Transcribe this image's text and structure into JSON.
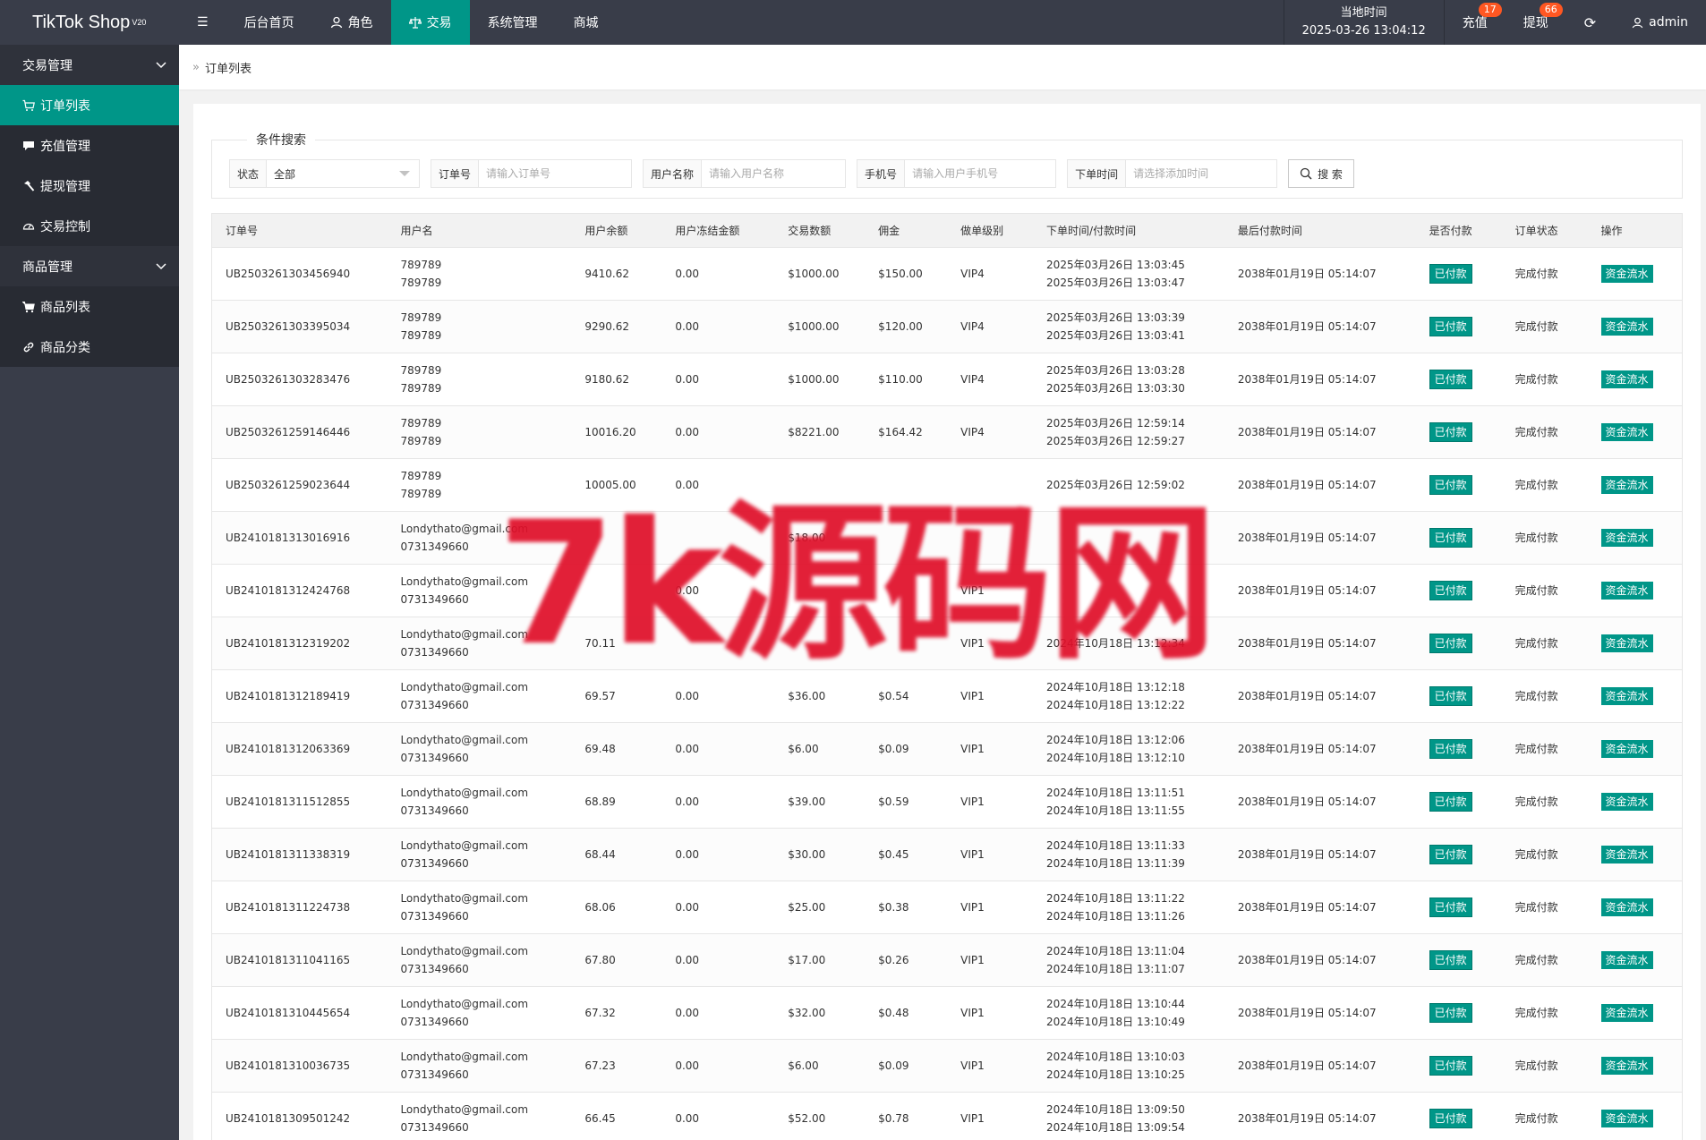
{
  "app": {
    "title": "TikTok Shop",
    "version": "V20"
  },
  "topnav": {
    "items": [
      {
        "label": "后台首页",
        "icon": "menu-icon"
      },
      {
        "label": "角色",
        "icon": "user-icon"
      },
      {
        "label": "交易",
        "icon": "scale-icon",
        "active": true
      },
      {
        "label": "系统管理",
        "icon": ""
      },
      {
        "label": "商城",
        "icon": ""
      }
    ],
    "clock_label": "当地时间",
    "clock_value": "2025-03-26 13:04:12",
    "recharge_label": "充值",
    "recharge_count": "17",
    "withdraw_label": "提现",
    "withdraw_count": "66",
    "user_label": "admin"
  },
  "sidebar": {
    "groups": [
      {
        "label": "交易管理",
        "items": [
          {
            "label": "订单列表",
            "icon": "cart-icon",
            "active": true
          },
          {
            "label": "充值管理",
            "icon": "chat-icon"
          },
          {
            "label": "提现管理",
            "icon": "hammer-icon"
          },
          {
            "label": "交易控制",
            "icon": "gauge-icon"
          }
        ]
      },
      {
        "label": "商品管理",
        "items": [
          {
            "label": "商品列表",
            "icon": "cart-icon"
          },
          {
            "label": "商品分类",
            "icon": "link-icon"
          }
        ]
      }
    ]
  },
  "breadcrumb": {
    "current": "订单列表"
  },
  "search": {
    "legend": "条件搜索",
    "status_label": "状态",
    "status_value": "全部",
    "order_label": "订单号",
    "order_placeholder": "请输入订单号",
    "username_label": "用户名称",
    "username_placeholder": "请输入用户名称",
    "phone_label": "手机号",
    "phone_placeholder": "请输入用户手机号",
    "time_label": "下单时间",
    "time_placeholder": "请选择添加时间",
    "button_label": "搜 索"
  },
  "table": {
    "headers": [
      "订单号",
      "用户名",
      "用户余额",
      "用户冻结金额",
      "交易数额",
      "佣金",
      "做单级别",
      "下单时间/付款时间",
      "最后付款时间",
      "是否付款",
      "订单状态",
      "操作"
    ],
    "paid_label": "已付款",
    "status_label": "完成付款",
    "action_label": "资金流水",
    "rows": [
      {
        "order": "UB2503261303456940",
        "user1": "789789",
        "user2": "789789",
        "balance": "9410.62",
        "frozen": "0.00",
        "amount": "$1000.00",
        "commission": "$150.00",
        "level": "VIP4",
        "t1": "2025年03月26日 13:03:45",
        "t2": "2025年03月26日 13:03:47",
        "last": "2038年01月19日 05:14:07"
      },
      {
        "order": "UB2503261303395034",
        "user1": "789789",
        "user2": "789789",
        "balance": "9290.62",
        "frozen": "0.00",
        "amount": "$1000.00",
        "commission": "$120.00",
        "level": "VIP4",
        "t1": "2025年03月26日 13:03:39",
        "t2": "2025年03月26日 13:03:41",
        "last": "2038年01月19日 05:14:07"
      },
      {
        "order": "UB2503261303283476",
        "user1": "789789",
        "user2": "789789",
        "balance": "9180.62",
        "frozen": "0.00",
        "amount": "$1000.00",
        "commission": "$110.00",
        "level": "VIP4",
        "t1": "2025年03月26日 13:03:28",
        "t2": "2025年03月26日 13:03:30",
        "last": "2038年01月19日 05:14:07"
      },
      {
        "order": "UB2503261259146446",
        "user1": "789789",
        "user2": "789789",
        "balance": "10016.20",
        "frozen": "0.00",
        "amount": "$8221.00",
        "commission": "$164.42",
        "level": "VIP4",
        "t1": "2025年03月26日 12:59:14",
        "t2": "2025年03月26日 12:59:27",
        "last": "2038年01月19日 05:14:07"
      },
      {
        "order": "UB2503261259023644",
        "user1": "789789",
        "user2": "789789",
        "balance": "10005.00",
        "frozen": "0.00",
        "amount": "",
        "commission": "",
        "level": "",
        "t1": "2025年03月26日 12:59:02",
        "t2": "",
        "last": "2038年01月19日 05:14:07"
      },
      {
        "order": "UB2410181313016916",
        "user1": "Londythato@gmail.com",
        "user2": "0731349660",
        "balance": "",
        "frozen": "",
        "amount": "$18.00",
        "commission": "",
        "level": "",
        "t1": "",
        "t2": "",
        "last": "2038年01月19日 05:14:07"
      },
      {
        "order": "UB2410181312424768",
        "user1": "Londythato@gmail.com",
        "user2": "0731349660",
        "balance": "",
        "frozen": "0.00",
        "amount": "",
        "commission": "",
        "level": "VIP1",
        "t1": "",
        "t2": "",
        "last": "2038年01月19日 05:14:07"
      },
      {
        "order": "UB2410181312319202",
        "user1": "Londythato@gmail.com",
        "user2": "0731349660",
        "balance": "70.11",
        "frozen": "",
        "amount": "",
        "commission": "",
        "level": "VIP1",
        "t1": "",
        "t2": "2024年10月18日 13:12:34",
        "last": "2038年01月19日 05:14:07"
      },
      {
        "order": "UB2410181312189419",
        "user1": "Londythato@gmail.com",
        "user2": "0731349660",
        "balance": "69.57",
        "frozen": "0.00",
        "amount": "$36.00",
        "commission": "$0.54",
        "level": "VIP1",
        "t1": "2024年10月18日 13:12:18",
        "t2": "2024年10月18日 13:12:22",
        "last": "2038年01月19日 05:14:07"
      },
      {
        "order": "UB2410181312063369",
        "user1": "Londythato@gmail.com",
        "user2": "0731349660",
        "balance": "69.48",
        "frozen": "0.00",
        "amount": "$6.00",
        "commission": "$0.09",
        "level": "VIP1",
        "t1": "2024年10月18日 13:12:06",
        "t2": "2024年10月18日 13:12:10",
        "last": "2038年01月19日 05:14:07"
      },
      {
        "order": "UB2410181311512855",
        "user1": "Londythato@gmail.com",
        "user2": "0731349660",
        "balance": "68.89",
        "frozen": "0.00",
        "amount": "$39.00",
        "commission": "$0.59",
        "level": "VIP1",
        "t1": "2024年10月18日 13:11:51",
        "t2": "2024年10月18日 13:11:55",
        "last": "2038年01月19日 05:14:07"
      },
      {
        "order": "UB2410181311338319",
        "user1": "Londythato@gmail.com",
        "user2": "0731349660",
        "balance": "68.44",
        "frozen": "0.00",
        "amount": "$30.00",
        "commission": "$0.45",
        "level": "VIP1",
        "t1": "2024年10月18日 13:11:33",
        "t2": "2024年10月18日 13:11:39",
        "last": "2038年01月19日 05:14:07"
      },
      {
        "order": "UB2410181311224738",
        "user1": "Londythato@gmail.com",
        "user2": "0731349660",
        "balance": "68.06",
        "frozen": "0.00",
        "amount": "$25.00",
        "commission": "$0.38",
        "level": "VIP1",
        "t1": "2024年10月18日 13:11:22",
        "t2": "2024年10月18日 13:11:26",
        "last": "2038年01月19日 05:14:07"
      },
      {
        "order": "UB2410181311041165",
        "user1": "Londythato@gmail.com",
        "user2": "0731349660",
        "balance": "67.80",
        "frozen": "0.00",
        "amount": "$17.00",
        "commission": "$0.26",
        "level": "VIP1",
        "t1": "2024年10月18日 13:11:04",
        "t2": "2024年10月18日 13:11:07",
        "last": "2038年01月19日 05:14:07"
      },
      {
        "order": "UB2410181310445654",
        "user1": "Londythato@gmail.com",
        "user2": "0731349660",
        "balance": "67.32",
        "frozen": "0.00",
        "amount": "$32.00",
        "commission": "$0.48",
        "level": "VIP1",
        "t1": "2024年10月18日 13:10:44",
        "t2": "2024年10月18日 13:10:49",
        "last": "2038年01月19日 05:14:07"
      },
      {
        "order": "UB2410181310036735",
        "user1": "Londythato@gmail.com",
        "user2": "0731349660",
        "balance": "67.23",
        "frozen": "0.00",
        "amount": "$6.00",
        "commission": "$0.09",
        "level": "VIP1",
        "t1": "2024年10月18日 13:10:03",
        "t2": "2024年10月18日 13:10:25",
        "last": "2038年01月19日 05:14:07"
      },
      {
        "order": "UB2410181309501242",
        "user1": "Londythato@gmail.com",
        "user2": "0731349660",
        "balance": "66.45",
        "frozen": "0.00",
        "amount": "$52.00",
        "commission": "$0.78",
        "level": "VIP1",
        "t1": "2024年10月18日 13:09:50",
        "t2": "2024年10月18日 13:09:54",
        "last": "2038年01月19日 05:14:07"
      }
    ]
  },
  "watermark": "7k源码网",
  "colors": {
    "topbar": "#393d49",
    "accent": "#009688",
    "badge": "#ff5722",
    "watermark": "#e0102a"
  }
}
